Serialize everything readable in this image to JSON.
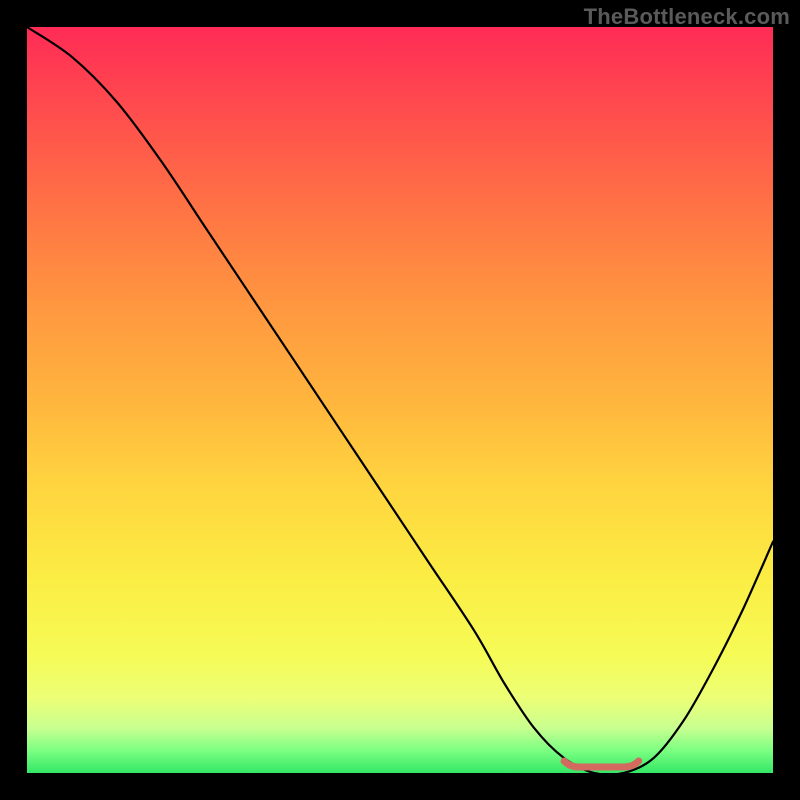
{
  "watermark": "TheBottleneck.com",
  "colors": {
    "page_bg": "#000000",
    "curve_stroke": "#000000",
    "flat_segment_stroke": "#d46a5f",
    "gradient_top": "#ff2b56",
    "gradient_bottom": "#33e766"
  },
  "chart_data": {
    "type": "line",
    "title": "",
    "xlabel": "",
    "ylabel": "",
    "xlim": [
      0,
      100
    ],
    "ylim": [
      0,
      100
    ],
    "grid": false,
    "legend": false,
    "annotations": [
      "TheBottleneck.com"
    ],
    "series": [
      {
        "name": "bottleneck-curve",
        "x": [
          0,
          6,
          12,
          18,
          24,
          30,
          36,
          42,
          48,
          54,
          60,
          64,
          68,
          72,
          76,
          80,
          84,
          88,
          92,
          96,
          100
        ],
        "values": [
          100,
          96,
          90,
          82,
          73,
          64,
          55,
          46,
          37,
          28,
          19,
          12,
          6,
          2,
          0,
          0,
          2,
          7,
          14,
          22,
          31
        ]
      }
    ],
    "flat_region": {
      "x_start": 72,
      "x_end": 82,
      "y": 0
    }
  }
}
